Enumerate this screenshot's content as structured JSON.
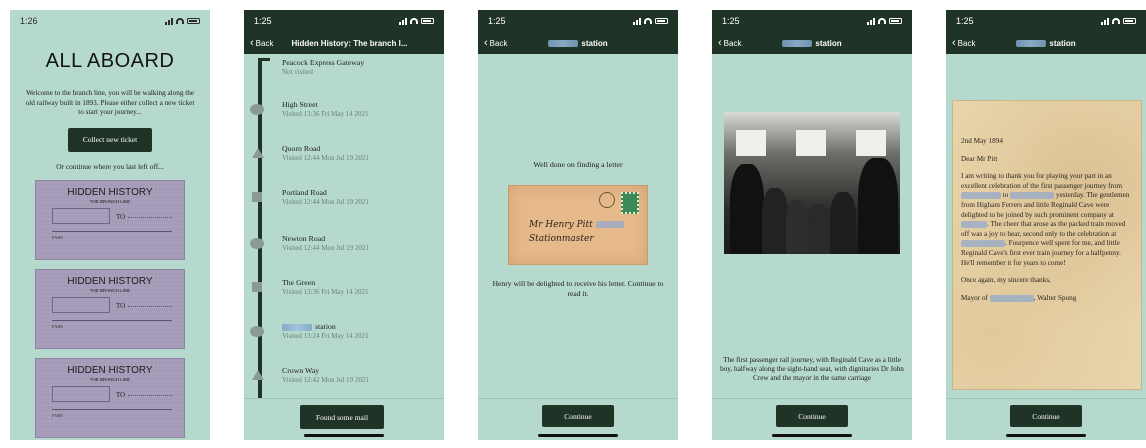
{
  "screen1": {
    "time": "1:26",
    "title": "ALL ABOARD",
    "welcome": "Welcome to the branch line, you will be walking along the old railway built in 1893. Please either collect a new ticket to start your journey...",
    "collect_button": "Collect new ticket",
    "continue_text": "Or continue where you last left off...",
    "ticket": {
      "title": "HIDDEN HISTORY",
      "subtitle": "THE BRANCH LINE",
      "to_label": "TO",
      "fare_label": "FARE"
    }
  },
  "screen2": {
    "time": "1:25",
    "back_label": "Back",
    "nav_title": "Hidden History: The branch l...",
    "stops": [
      {
        "name": "Peacock Express Gateway",
        "status": "Not visited"
      },
      {
        "name": "High Street",
        "status": "Visited 13:36 Fri May 14 2021"
      },
      {
        "name": "Quorn Road",
        "status": "Visited 12:44 Mon Jul 19 2021"
      },
      {
        "name": "Portland Road",
        "status": "Visited 12:44 Mon Jul 19 2021"
      },
      {
        "name": "Newton Road",
        "status": "Visited 12:44 Mon Jul 19 2021"
      },
      {
        "name": "The Green",
        "status": "Visited 13:36 Fri May 14 2021"
      },
      {
        "name": "station",
        "status": "Visited 13:24 Fri May 14 2021"
      },
      {
        "name": "Crown Way",
        "status": "Visited 12:42 Mon Jul 19 2021"
      }
    ],
    "mail_button": "Found some mail"
  },
  "screen3": {
    "time": "1:25",
    "back_label": "Back",
    "nav_title": "station",
    "message": "Well done on finding a letter",
    "envelope_name": "Mr Henry Pitt",
    "envelope_role": "Stationmaster",
    "subtext": "Henry will be delighted to receive his letter. Continue to read it.",
    "continue_button": "Continue"
  },
  "screen4": {
    "time": "1:25",
    "back_label": "Back",
    "nav_title": "station",
    "caption": "The first passenger rail journey, with Reginald Cave as a little boy, halfway along the sight-hand seat, with dignitaries Dr John Crew and the mayor in the same carriage",
    "continue_button": "Continue"
  },
  "screen5": {
    "time": "1:25",
    "back_label": "Back",
    "nav_title": "station",
    "letter": {
      "date": "2nd May 1894",
      "salutation": "Dear Mr Pitt",
      "p1_a": "I am writing to thank you for playing your part in an excellent celebration of the first passenger journey from",
      "p1_b": "to",
      "p1_c": "yesterday. The gentlemen from Higham Ferrers and little Reginald Cave were delighted to be joined by such prominent company at",
      "p1_d": ". The cheer that arose as the packed train moved off was a joy to hear, second only to the celebration at",
      "p1_e": ". Fourpence well spent for me, and little Reginald Cave's first ever train journey for a halfpenny. He'll remember it for years to come!",
      "closing": "Once again, my sincere thanks,",
      "sign_a": "Mayor of",
      "sign_b": ", Walter Spong"
    },
    "continue_button": "Continue"
  }
}
